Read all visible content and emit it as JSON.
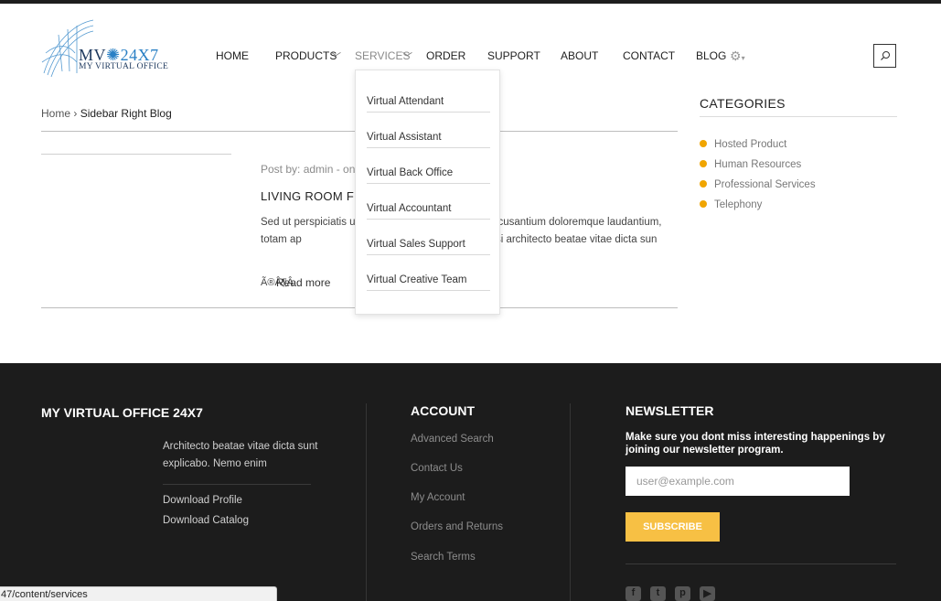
{
  "logo": {
    "brand_left": "MV",
    "brand_right": "24X7",
    "tagline": "MY VIRTUAL OFFICE"
  },
  "nav": {
    "items": [
      "HOME",
      "PRODUCTS",
      "SERVICES",
      "ORDER",
      "SUPPORT",
      "ABOUT",
      "CONTACT",
      "BLOG"
    ],
    "active": "SERVICES"
  },
  "services_menu": [
    "Virtual Attendant",
    "Virtual Assistant",
    "Virtual Back Office",
    "Virtual Accountant",
    "Virtual Sales Support",
    "Virtual Creative Team"
  ],
  "breadcrumb": {
    "home": "Home",
    "separator": "›",
    "current": "Sidebar Right Blog"
  },
  "post": {
    "meta": "Post by: admin - on M",
    "title": "LIVING ROOM FU",
    "excerpt": "Sed ut perspiciatis un                               ptatem accusantium doloremque laudantium, totam ap                              ventore veritatis et quasi architecto beatae vitae dicta sun",
    "glyph": "Ã®Â¶Â",
    "read_more": "Read more"
  },
  "sidebar": {
    "title": "CATEGORIES",
    "categories": [
      "Hosted Product",
      "Human Resources",
      "Professional Services",
      "Telephony"
    ],
    "bullet_color": "#f0a500"
  },
  "footer": {
    "about": {
      "title": "MY VIRTUAL OFFICE 24X7",
      "text": "Architecto beatae vitae dicta sunt explicabo. Nemo enim",
      "links": [
        "Download Profile",
        "Download Catalog"
      ]
    },
    "account": {
      "title": "ACCOUNT",
      "links": [
        "Advanced Search",
        "Contact Us",
        "My Account",
        "Orders and Returns",
        "Search Terms"
      ]
    },
    "newsletter": {
      "title": "NEWSLETTER",
      "text": "Make sure you dont miss interesting happenings by joining our newsletter program.",
      "placeholder": "user@example.com",
      "button": "SUBSCRIBE",
      "button_color": "#f7c044"
    },
    "social": [
      "facebook-icon",
      "twitter-icon",
      "pinterest-icon",
      "youtube-icon"
    ]
  },
  "status_url": "47/content/services"
}
